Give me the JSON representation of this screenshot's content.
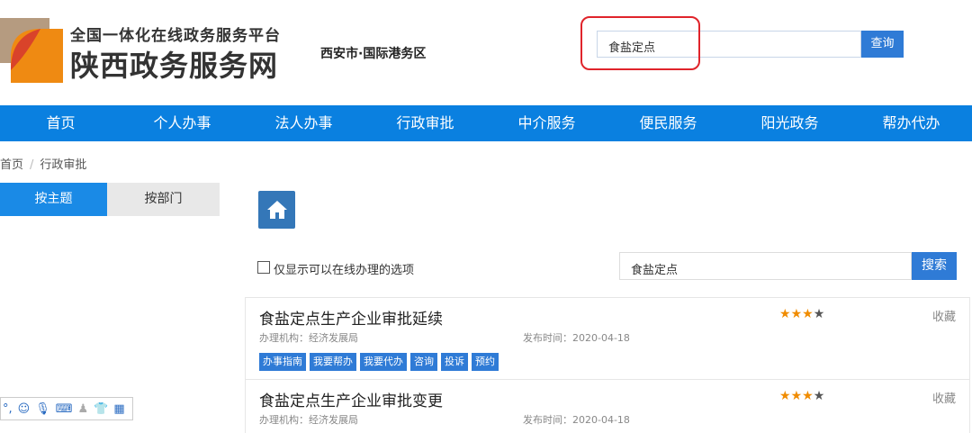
{
  "header": {
    "logo_sub": "全国一体化在线政务服务平台",
    "logo_main": "陕西政务服务网",
    "region": "西安市·国际港务区",
    "search_value": "食盐定点",
    "search_button": "查询"
  },
  "nav": [
    "首页",
    "个人办事",
    "法人办事",
    "行政审批",
    "中介服务",
    "便民服务",
    "阳光政务",
    "帮办代办"
  ],
  "breadcrumb": [
    "首页",
    "行政审批"
  ],
  "tabs": [
    "按主题",
    "按部门"
  ],
  "filter": {
    "online_only_label": "仅显示可以在线办理的选项",
    "search_value": "食盐定点",
    "search_button": "搜索"
  },
  "items": [
    {
      "title": "食盐定点生产企业审批延续",
      "org": "办理机构：经济发展局",
      "date": "发布时间：2020-04-18",
      "rating": 3,
      "fav": "收藏",
      "actions": [
        "办事指南",
        "我要帮办",
        "我要代办",
        "咨询",
        "投诉",
        "预约"
      ]
    },
    {
      "title": "食盐定点生产企业审批变更",
      "org": "办理机构：经济发展局",
      "date": "发布时间：2020-04-18",
      "rating": 3,
      "fav": "收藏"
    }
  ],
  "colors": {
    "nav": "#0a80e0",
    "button": "#2f7bd6",
    "star": "#f08c00",
    "highlight": "#e0242b"
  }
}
